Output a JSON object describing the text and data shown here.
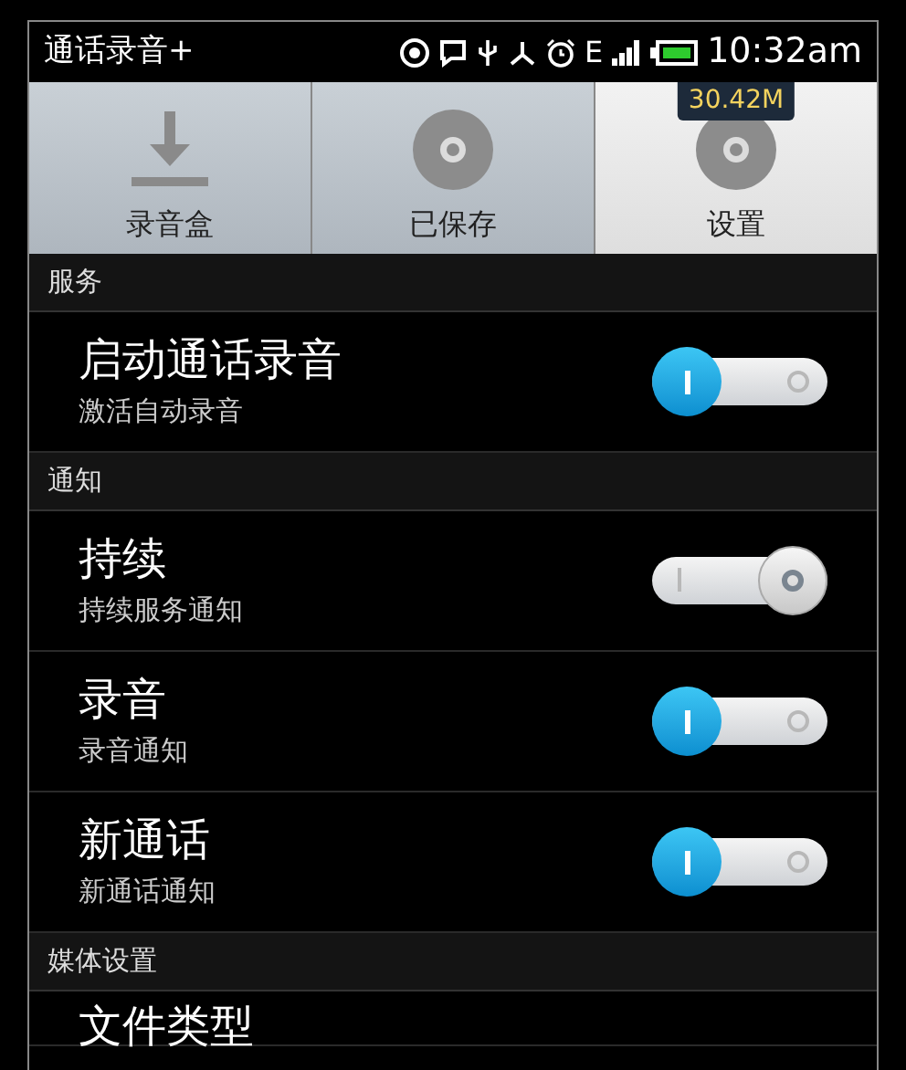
{
  "status_bar": {
    "app_title": "通话录音+",
    "time": "10:32am",
    "network": "E"
  },
  "tabs": [
    {
      "label": "录音盒",
      "kind": "download",
      "selected": false
    },
    {
      "label": "已保存",
      "kind": "disc",
      "selected": false
    },
    {
      "label": "设置",
      "kind": "disc",
      "selected": true,
      "badge": "30.42M"
    }
  ],
  "sections": [
    {
      "title": "服务",
      "items": [
        {
          "title": "启动通话录音",
          "subtitle": "激活自动录音",
          "on": true
        }
      ]
    },
    {
      "title": "通知",
      "items": [
        {
          "title": "持续",
          "subtitle": "持续服务通知",
          "on": false
        },
        {
          "title": "录音",
          "subtitle": "录音通知",
          "on": true
        },
        {
          "title": "新通话",
          "subtitle": "新通话通知",
          "on": true
        }
      ]
    },
    {
      "title": "媒体设置",
      "items": [
        {
          "title": "文件类型"
        }
      ]
    }
  ]
}
